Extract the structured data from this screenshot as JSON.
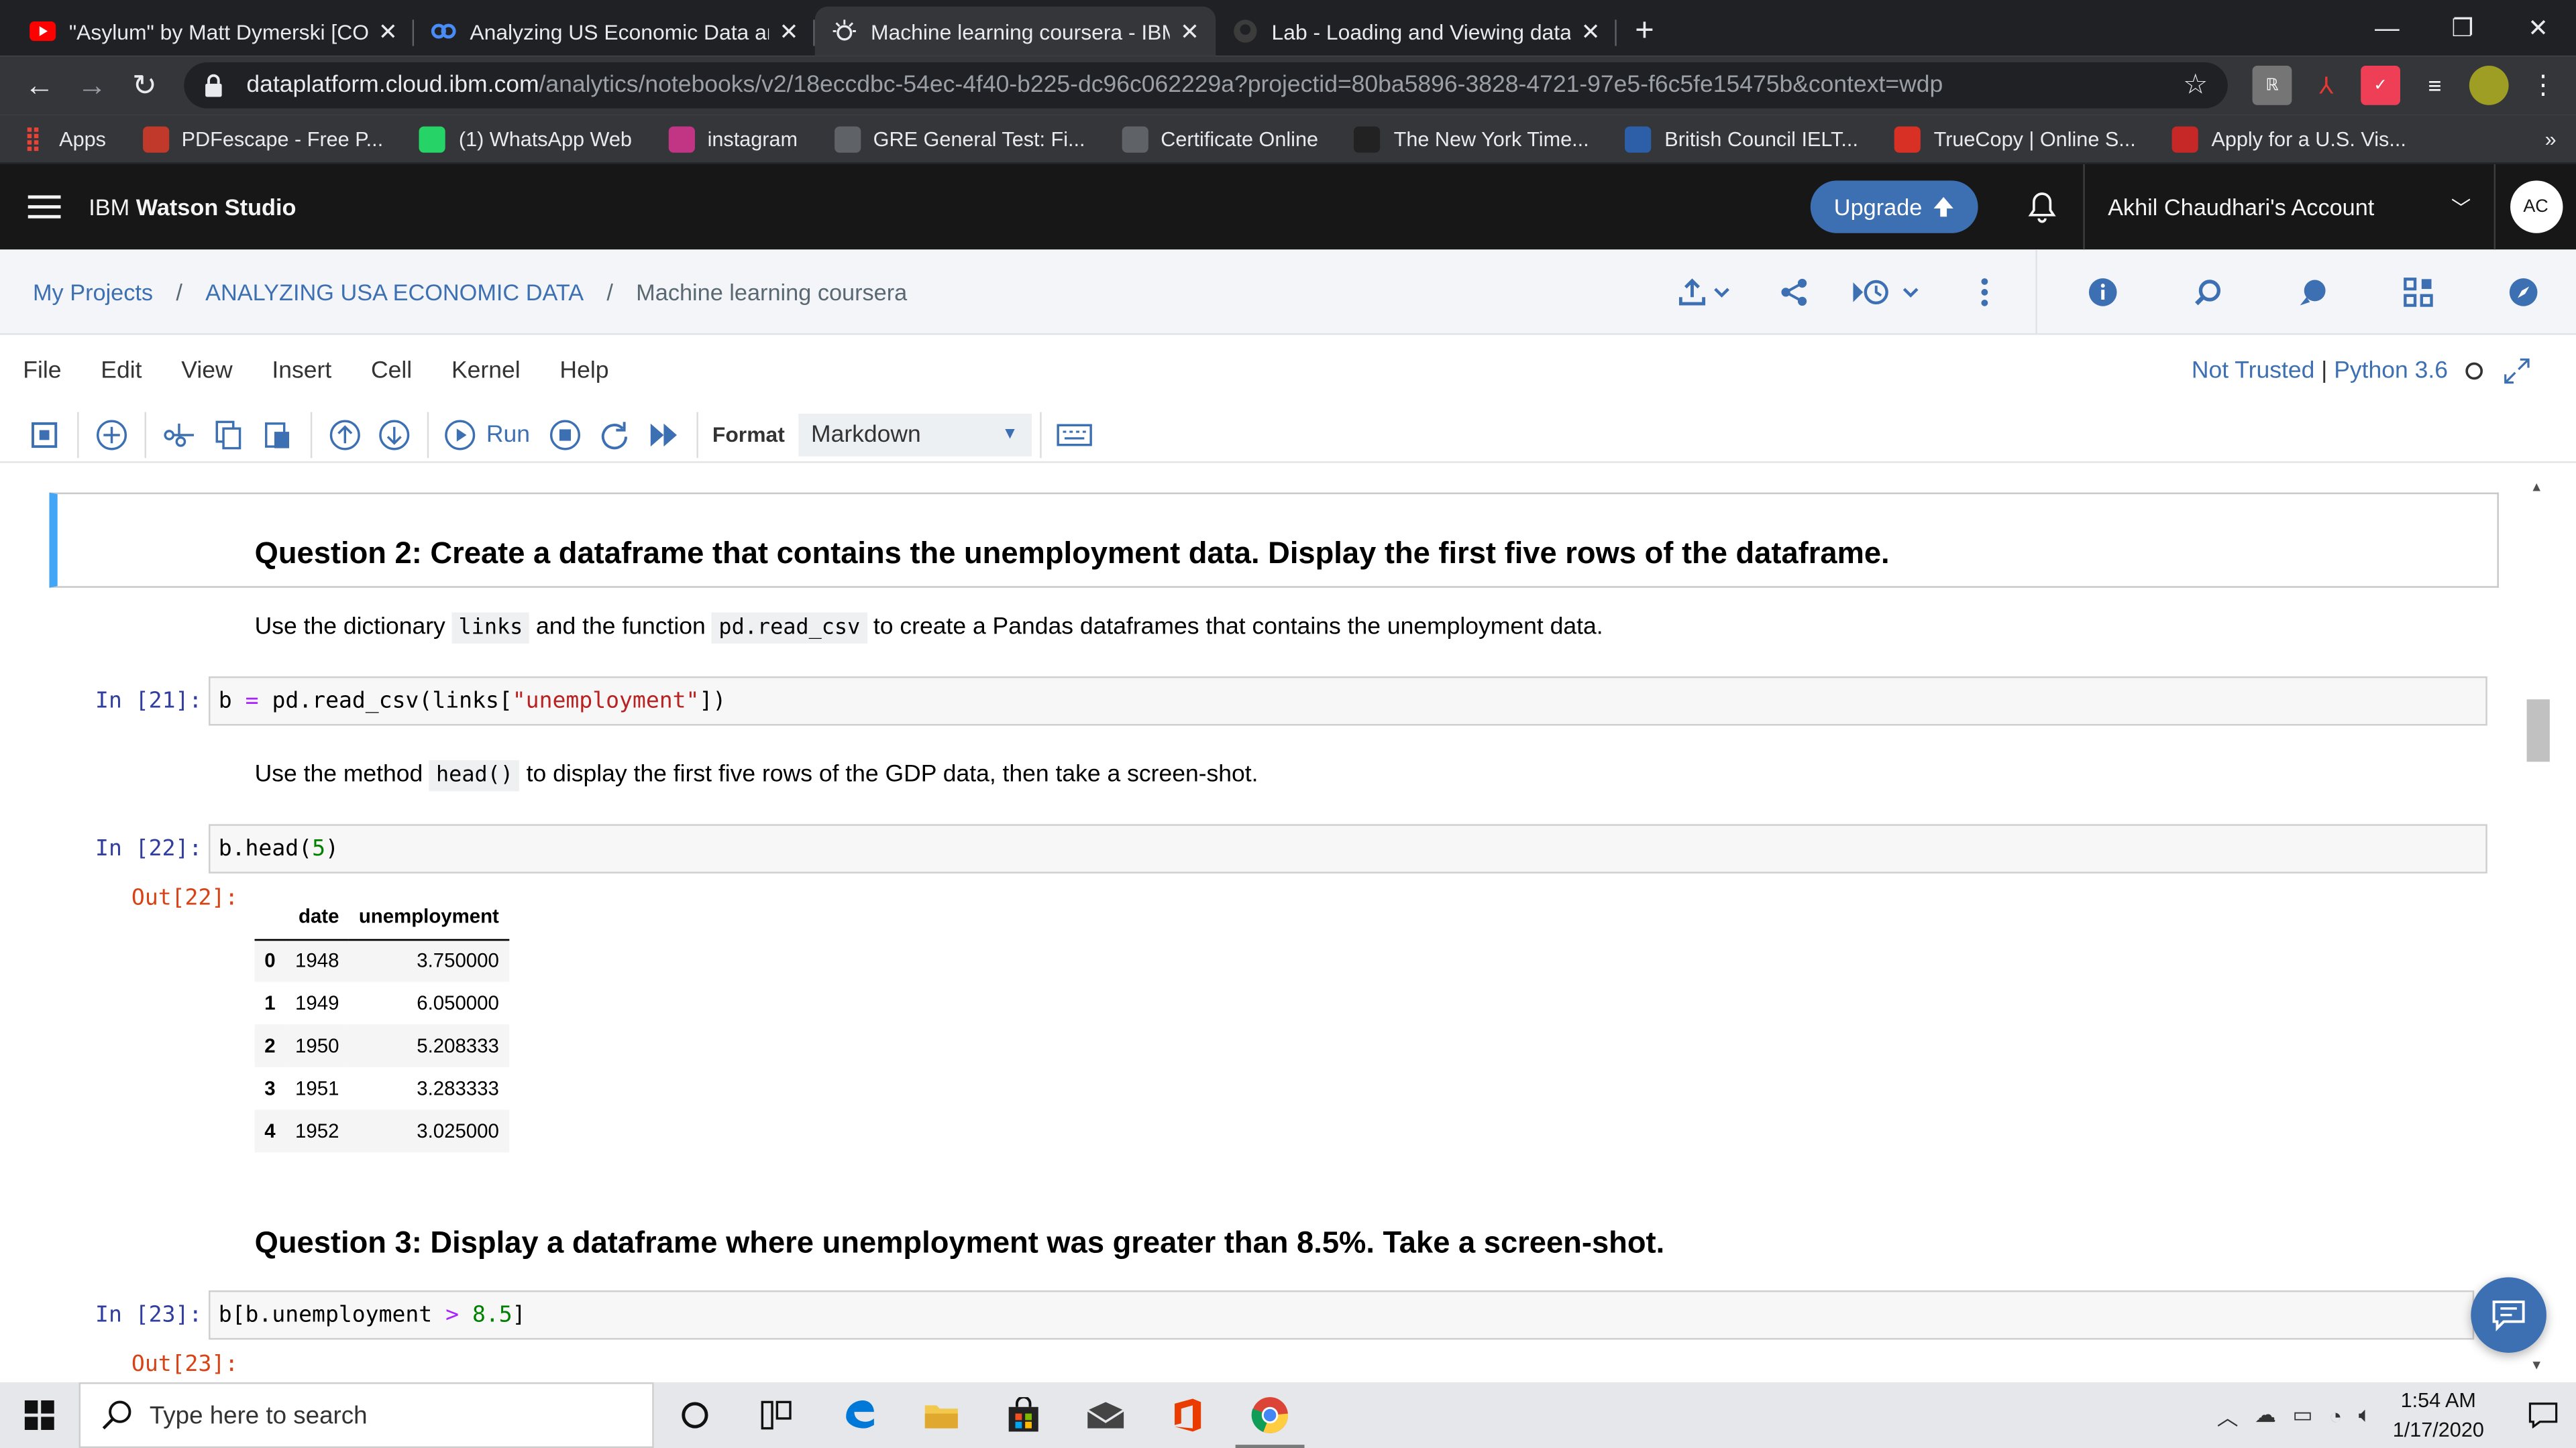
{
  "browser": {
    "tabs": [
      {
        "title": "\"Asylum\" by Matt Dymerski [COM",
        "icon": "youtube-icon",
        "active": false
      },
      {
        "title": "Analyzing US Economic Data and",
        "icon": "coursera-icon",
        "active": false
      },
      {
        "title": "Machine learning coursera - IBM",
        "icon": "watson-icon",
        "active": true
      },
      {
        "title": "Lab - Loading and Viewing data.i",
        "icon": "github-icon",
        "active": false
      }
    ],
    "url_host": "dataplatform.cloud.ibm.com",
    "url_path": "/analytics/notebooks/v2/18eccdbc-54ec-4f40-b225-dc96c062229a?projectid=80ba5896-3828-4721-97e5-f6c5fe15475b&context=wdp",
    "bookmarks": [
      {
        "label": "Apps",
        "icon": "apps-icon",
        "color": "#ea4335"
      },
      {
        "label": "PDFescape - Free P...",
        "icon": "pdf-icon",
        "color": "#c0392b"
      },
      {
        "label": "(1) WhatsApp Web",
        "icon": "whatsapp-icon",
        "color": "#25d366"
      },
      {
        "label": "instagram",
        "icon": "instagram-icon",
        "color": "#c13584"
      },
      {
        "label": "GRE General Test: Fi...",
        "icon": "globe-icon",
        "color": "#5f6368"
      },
      {
        "label": "Certificate Online",
        "icon": "globe-icon",
        "color": "#5f6368"
      },
      {
        "label": "The New York Time...",
        "icon": "nyt-icon",
        "color": "#222222"
      },
      {
        "label": "British Council IELT...",
        "icon": "ors-icon",
        "color": "#2d5fa8"
      },
      {
        "label": "TrueCopy | Online S...",
        "icon": "truecopy-icon",
        "color": "#d93025"
      },
      {
        "label": "Apply for a U.S. Vis...",
        "icon": "cgi-icon",
        "color": "#c62828"
      }
    ],
    "more_bookmarks": "»"
  },
  "app": {
    "brand_prefix": "IBM",
    "brand_name": "Watson Studio",
    "upgrade_label": "Upgrade",
    "account_label": "Akhil Chaudhari's Account",
    "avatar_initials": "AC",
    "accent": "#3d70b2"
  },
  "breadcrumb": {
    "items": [
      "My Projects",
      "ANALYZING USA ECONOMIC DATA",
      "Machine learning coursera"
    ],
    "separator": "/"
  },
  "menu": {
    "items": [
      "File",
      "Edit",
      "View",
      "Insert",
      "Cell",
      "Kernel",
      "Help"
    ],
    "trust": "Not Trusted",
    "kernel": "Python 3.6"
  },
  "toolbar": {
    "run_label": "Run",
    "format_label": "Format",
    "format_value": "Markdown"
  },
  "notebook": {
    "q2_heading": "Question 2: Create a dataframe that contains the unemployment data. Display the first five rows of the dataframe.",
    "q2_text_pre": "Use the dictionary ",
    "q2_code1": "links",
    "q2_text_mid": " and the function ",
    "q2_code2": "pd.read_csv",
    "q2_text_post": " to create a Pandas dataframes that contains the unemployment data.",
    "in21_prompt": "In [21]:",
    "in21_var": "b",
    "in21_eq": "=",
    "in21_call": "pd.read_csv(links[",
    "in21_str": "\"unemployment\"",
    "in21_close": "])",
    "head_text_pre": "Use the method ",
    "head_code": "head()",
    "head_text_post": " to display the first five rows of the GDP data, then take a screen-shot.",
    "in22_prompt": "In [22]:",
    "in22_code": "b.head(",
    "in22_num": "5",
    "in22_close": ")",
    "out22_prompt": "Out[22]:",
    "table": {
      "columns": [
        "date",
        "unemployment"
      ],
      "rows": [
        {
          "index": "0",
          "date": "1948",
          "unemployment": "3.750000"
        },
        {
          "index": "1",
          "date": "1949",
          "unemployment": "6.050000"
        },
        {
          "index": "2",
          "date": "1950",
          "unemployment": "5.208333"
        },
        {
          "index": "3",
          "date": "1951",
          "unemployment": "3.283333"
        },
        {
          "index": "4",
          "date": "1952",
          "unemployment": "3.025000"
        }
      ]
    },
    "q3_heading": "Question 3: Display a dataframe where unemployment was greater than 8.5%. Take a screen-shot.",
    "in23_prompt": "In [23]:",
    "in23_code": "b[b.unemployment ",
    "in23_op": ">",
    "in23_num": " 8.5",
    "in23_close": "]",
    "out23_prompt": "Out[23]:"
  },
  "taskbar": {
    "search_placeholder": "Type here to search",
    "time": "1:54 AM",
    "date": "1/17/2020"
  }
}
